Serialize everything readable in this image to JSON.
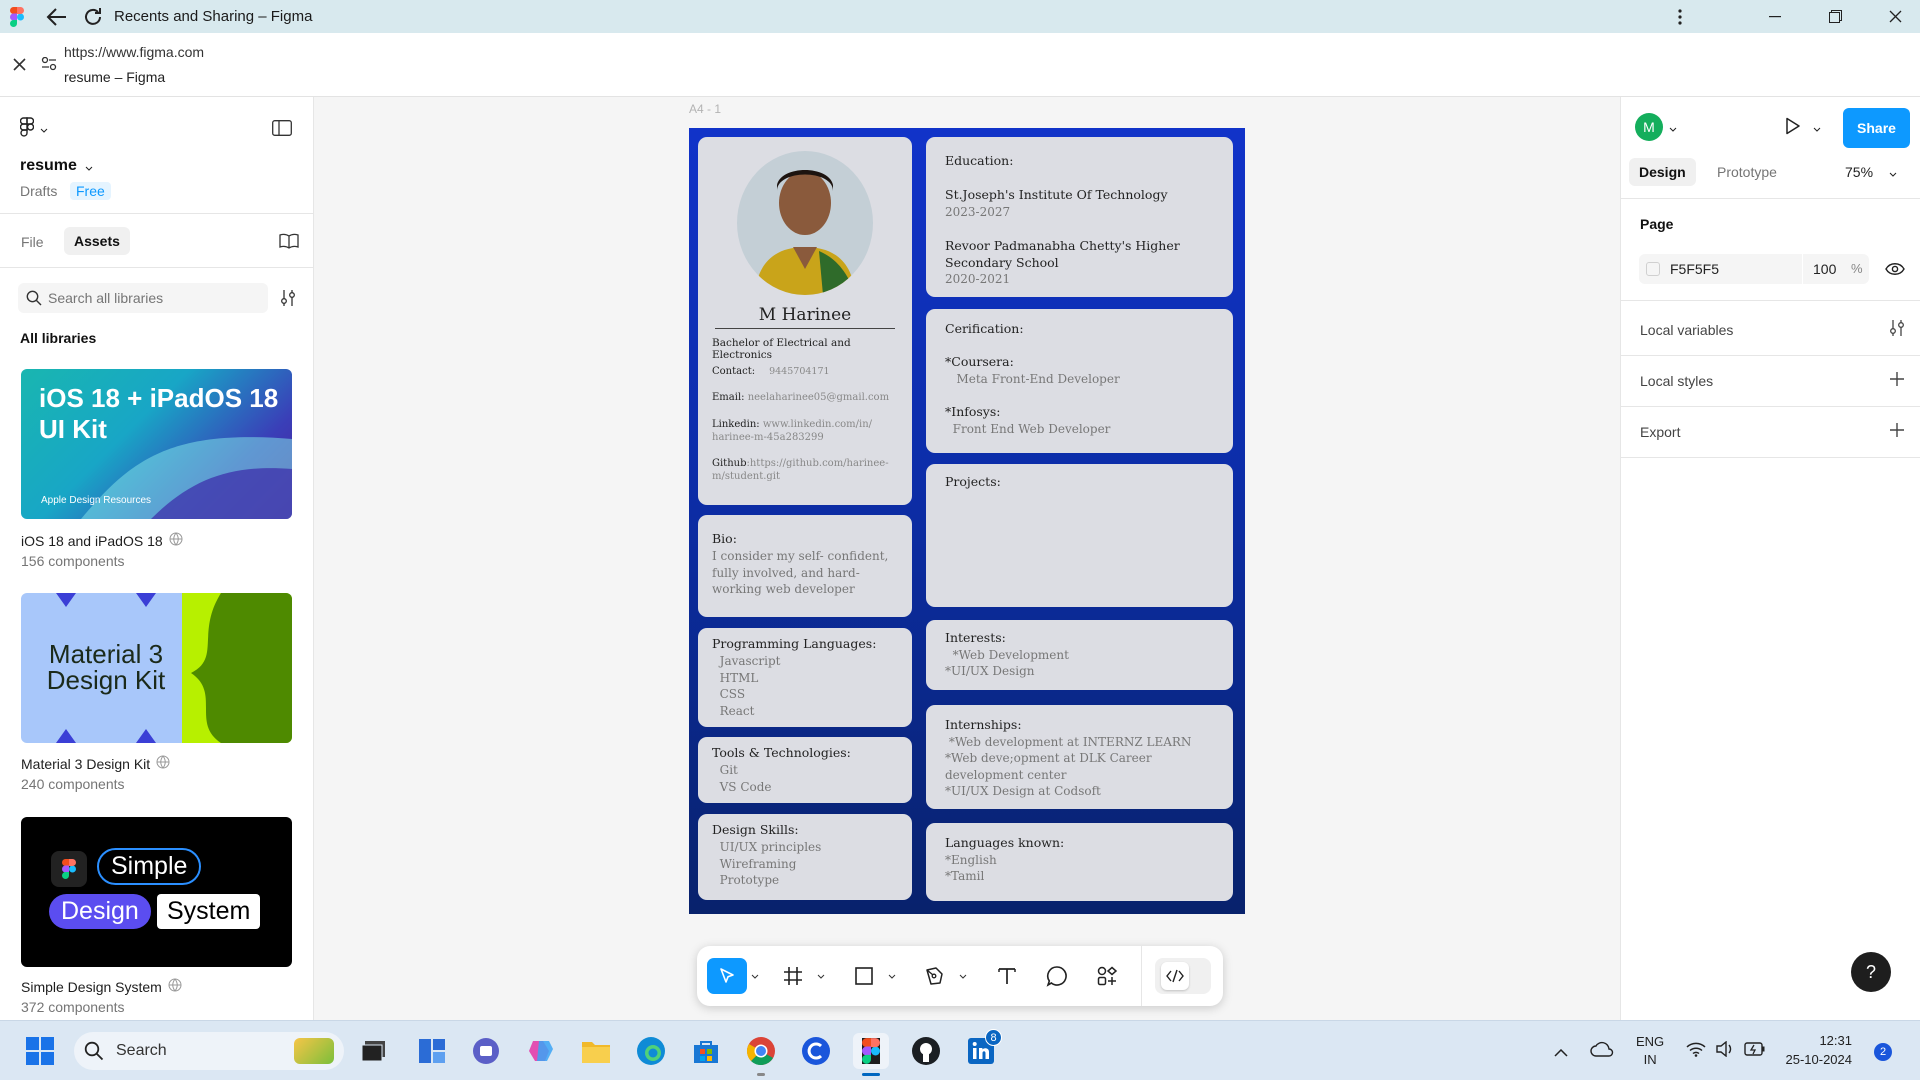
{
  "window": {
    "title": "Recents and Sharing – Figma"
  },
  "urlbar": {
    "url": "https://www.figma.com",
    "page_title": "resume – Figma"
  },
  "left_panel": {
    "file_name": "resume",
    "drafts": "Drafts",
    "plan": "Free",
    "tabs": [
      {
        "label": "File"
      },
      {
        "label": "Assets"
      }
    ],
    "search_placeholder": "Search all libraries",
    "section_title": "All libraries",
    "libraries": [
      {
        "thumb_title": "iOS 18 + iPadOS 18 UI Kit",
        "thumb_footer": "Apple Design Resources",
        "name": "iOS 18 and iPadOS 18",
        "count": "156 components"
      },
      {
        "thumb_title": "Material 3 Design Kit",
        "name": "Material 3 Design Kit",
        "count": "240 components"
      },
      {
        "thumb_words": [
          "Simple",
          "Design",
          "System"
        ],
        "name": "Simple Design System",
        "count": "372 components"
      }
    ]
  },
  "canvas": {
    "frame_label": "A4 - 1",
    "resume": {
      "name": "M Harinee",
      "degree": "Bachelor of Electrical and Electronics",
      "contact_label": "Contact:",
      "contact_value": "9445704171",
      "email_label": "Email:",
      "email_value": "neelaharinee05@gmail.com",
      "linkedin_label": "Linkedin:",
      "linkedin_value_1": "www.linkedin.com/in/",
      "linkedin_value_2": "harinee-m-45a283299",
      "github_label": "Github",
      "github_value_1": ":https://github.com/harinee-",
      "github_value_2": "m/student.git",
      "bio_title": "Bio:",
      "bio_lines": [
        "I consider my self- confident,",
        "fully involved, and hard-",
        "working web developer"
      ],
      "prog_title": "Programming Languages:",
      "prog_items": [
        "  Javascript",
        "  HTML",
        "  CSS",
        "  React"
      ],
      "tools_title": "Tools & Technologies:",
      "tools_items": [
        "  Git",
        "  VS Code"
      ],
      "design_title": "Design Skills:",
      "design_items": [
        "  UI/UX principles",
        "  Wireframing",
        "  Prototype"
      ],
      "edu_title": "Education:",
      "edu_1_name": "St.Joseph's Institute Of Technology",
      "edu_1_years": "2023-2027",
      "edu_2_name_1": "Revoor Padmanabha Chetty's Higher",
      "edu_2_name_2": "Secondary School",
      "edu_2_years": "2020-2021",
      "cert_title": "Cerification:",
      "cert_1_org": "*Coursera:",
      "cert_1_name": "   Meta Front-End Developer",
      "cert_2_org": "*Infosys:",
      "cert_2_name": "  Front End Web Developer",
      "projects_title": "Projects:",
      "interests_title": "Interests:",
      "interests_items": [
        "  *Web Development",
        "*UI/UX Design"
      ],
      "intern_title": "Internships:",
      "intern_items": [
        " *Web development at INTERNZ LEARN",
        "*Web deve;opment at DLK Career",
        "development center",
        "*UI/UX Design at Codsoft"
      ],
      "lang_title": "Languages known:",
      "lang_items": [
        "*English",
        "*Tamil"
      ]
    }
  },
  "right_panel": {
    "avatar_letter": "M",
    "share_label": "Share",
    "tabs": [
      {
        "label": "Design"
      },
      {
        "label": "Prototype"
      }
    ],
    "zoom": "75%",
    "page_section": "Page",
    "page_color": "F5F5F5",
    "page_opacity": "100",
    "percent": "%",
    "local_variables": "Local variables",
    "local_styles": "Local styles",
    "export": "Export",
    "help": "?"
  },
  "taskbar": {
    "search_label": "Search",
    "lang_1": "ENG",
    "lang_2": "IN",
    "time": "12:31",
    "date": "25-10-2024",
    "notif_count": "2",
    "linkedin_badge": "8"
  },
  "colors": {
    "accent": "#0d99ff",
    "frame_top": "#1133c9",
    "frame_bottom": "#08226c",
    "card": "#dcdde3"
  }
}
